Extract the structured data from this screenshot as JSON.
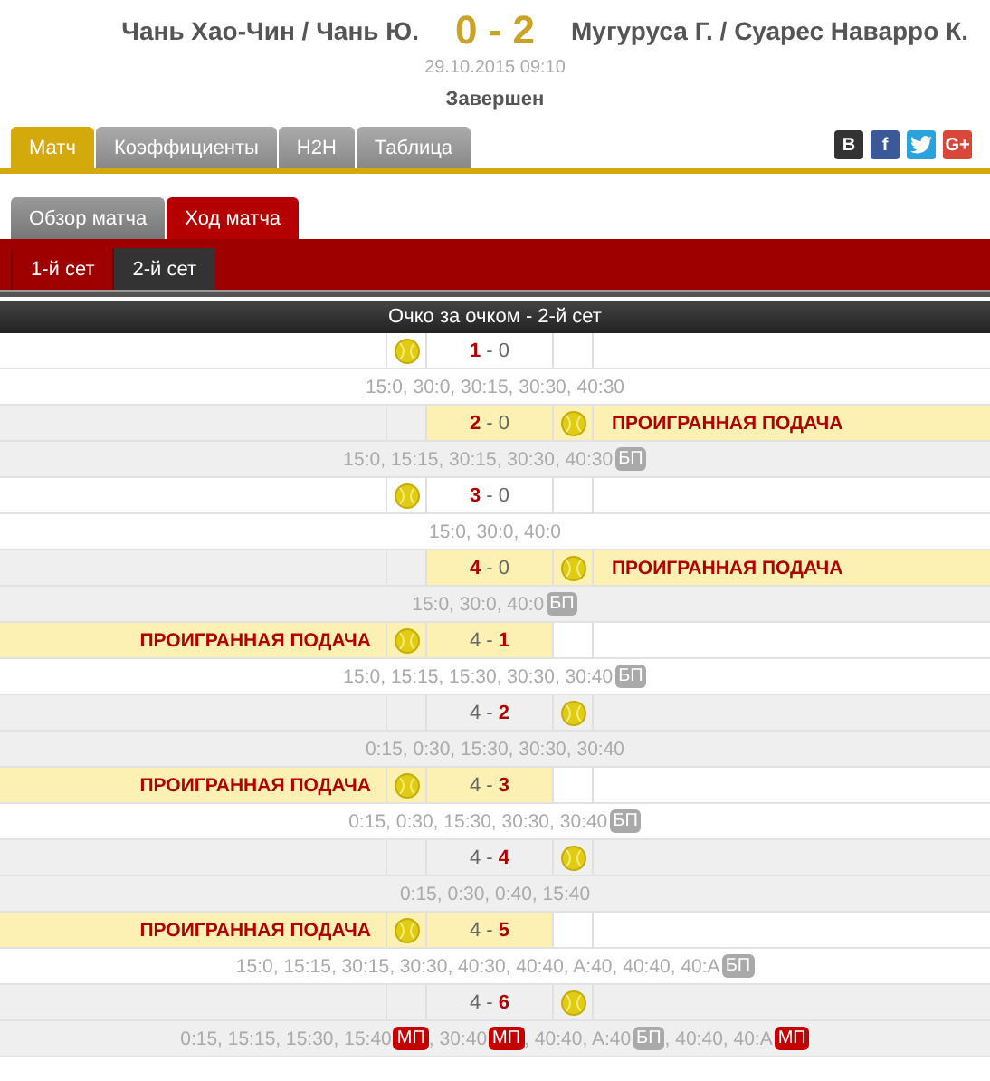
{
  "match": {
    "home": "Чань Хао-Чин / Чань Ю.",
    "score": "0 - 2",
    "away": "Мугуруса Г. / Суарес Наварро К.",
    "datetime": "29.10.2015 09:10",
    "status": "Завершен"
  },
  "tabs": [
    {
      "label": "Матч",
      "selected": true
    },
    {
      "label": "Коэффициенты",
      "selected": false
    },
    {
      "label": "H2H",
      "selected": false
    },
    {
      "label": "Таблица",
      "selected": false
    }
  ],
  "social": [
    {
      "kind": "vk",
      "text": "В"
    },
    {
      "kind": "facebook",
      "text": "f"
    },
    {
      "kind": "twitter"
    },
    {
      "kind": "gplus",
      "text": "G+"
    }
  ],
  "subtabs": [
    {
      "label": "Обзор матча",
      "selected": false
    },
    {
      "label": "Ход матча",
      "selected": true
    }
  ],
  "sets": [
    {
      "label": "1-й сет",
      "selected": false
    },
    {
      "label": "2-й сет",
      "selected": true
    }
  ],
  "section_title": "Очко за очком - 2-й сет",
  "games": [
    {
      "score": "**1** - 0",
      "home_serving": true,
      "lost_serve": false,
      "points": [
        {
          "kind": "text",
          "text": "15:0, 30:0, 30:15, 30:30, 40:30"
        }
      ]
    },
    {
      "score": "**2** - 0",
      "home_serving": false,
      "lost_serve": true,
      "note": "ПРОИГРАННАЯ ПОДАЧА",
      "points": [
        {
          "kind": "text",
          "text": "15:0, 15:15, 30:15, 30:30, 40:30"
        },
        {
          "kind": "bp",
          "text": "БП"
        }
      ]
    },
    {
      "score": "**3** - 0",
      "home_serving": true,
      "lost_serve": false,
      "points": [
        {
          "kind": "text",
          "text": "15:0, 30:0, 40:0"
        }
      ]
    },
    {
      "score": "**4** - 0",
      "home_serving": false,
      "lost_serve": true,
      "note": "ПРОИГРАННАЯ ПОДАЧА",
      "points": [
        {
          "kind": "text",
          "text": "15:0, 30:0, 40:0"
        },
        {
          "kind": "bp",
          "text": "БП"
        }
      ]
    },
    {
      "score": "4 - **1**",
      "home_serving": true,
      "lost_serve": true,
      "note": "ПРОИГРАННАЯ ПОДАЧА",
      "points": [
        {
          "kind": "text",
          "text": "15:0, 15:15, 15:30, 30:30, 30:40"
        },
        {
          "kind": "bp",
          "text": "БП"
        }
      ]
    },
    {
      "score": "4 - **2**",
      "home_serving": false,
      "lost_serve": false,
      "points": [
        {
          "kind": "text",
          "text": "0:15, 0:30, 15:30, 30:30, 30:40"
        }
      ]
    },
    {
      "score": "4 - **3**",
      "home_serving": true,
      "lost_serve": true,
      "note": "ПРОИГРАННАЯ ПОДАЧА",
      "points": [
        {
          "kind": "text",
          "text": "0:15, 0:30, 15:30, 30:30, 30:40"
        },
        {
          "kind": "bp",
          "text": "БП"
        }
      ]
    },
    {
      "score": "4 - **4**",
      "home_serving": false,
      "lost_serve": false,
      "points": [
        {
          "kind": "text",
          "text": "0:15, 0:30, 0:40, 15:40"
        }
      ]
    },
    {
      "score": "4 - **5**",
      "home_serving": true,
      "lost_serve": true,
      "note": "ПРОИГРАННАЯ ПОДАЧА",
      "points": [
        {
          "kind": "text",
          "text": "15:0, 15:15, 30:15, 30:30, 40:30, 40:40, A:40, 40:40, 40:A"
        },
        {
          "kind": "bp",
          "text": "БП"
        }
      ]
    },
    {
      "score": "4 - **6**",
      "home_serving": false,
      "lost_serve": false,
      "points": [
        {
          "kind": "text",
          "text": "0:15, 15:15, 15:30, 15:40"
        },
        {
          "kind": "mp",
          "text": "МП"
        },
        {
          "kind": "text",
          "text": ", 30:40"
        },
        {
          "kind": "mp",
          "text": "МП"
        },
        {
          "kind": "text",
          "text": ", 40:40, A:40"
        },
        {
          "kind": "bp",
          "text": "БП"
        },
        {
          "kind": "text",
          "text": ", 40:40, 40:A"
        },
        {
          "kind": "mp",
          "text": "МП"
        }
      ]
    }
  ]
}
